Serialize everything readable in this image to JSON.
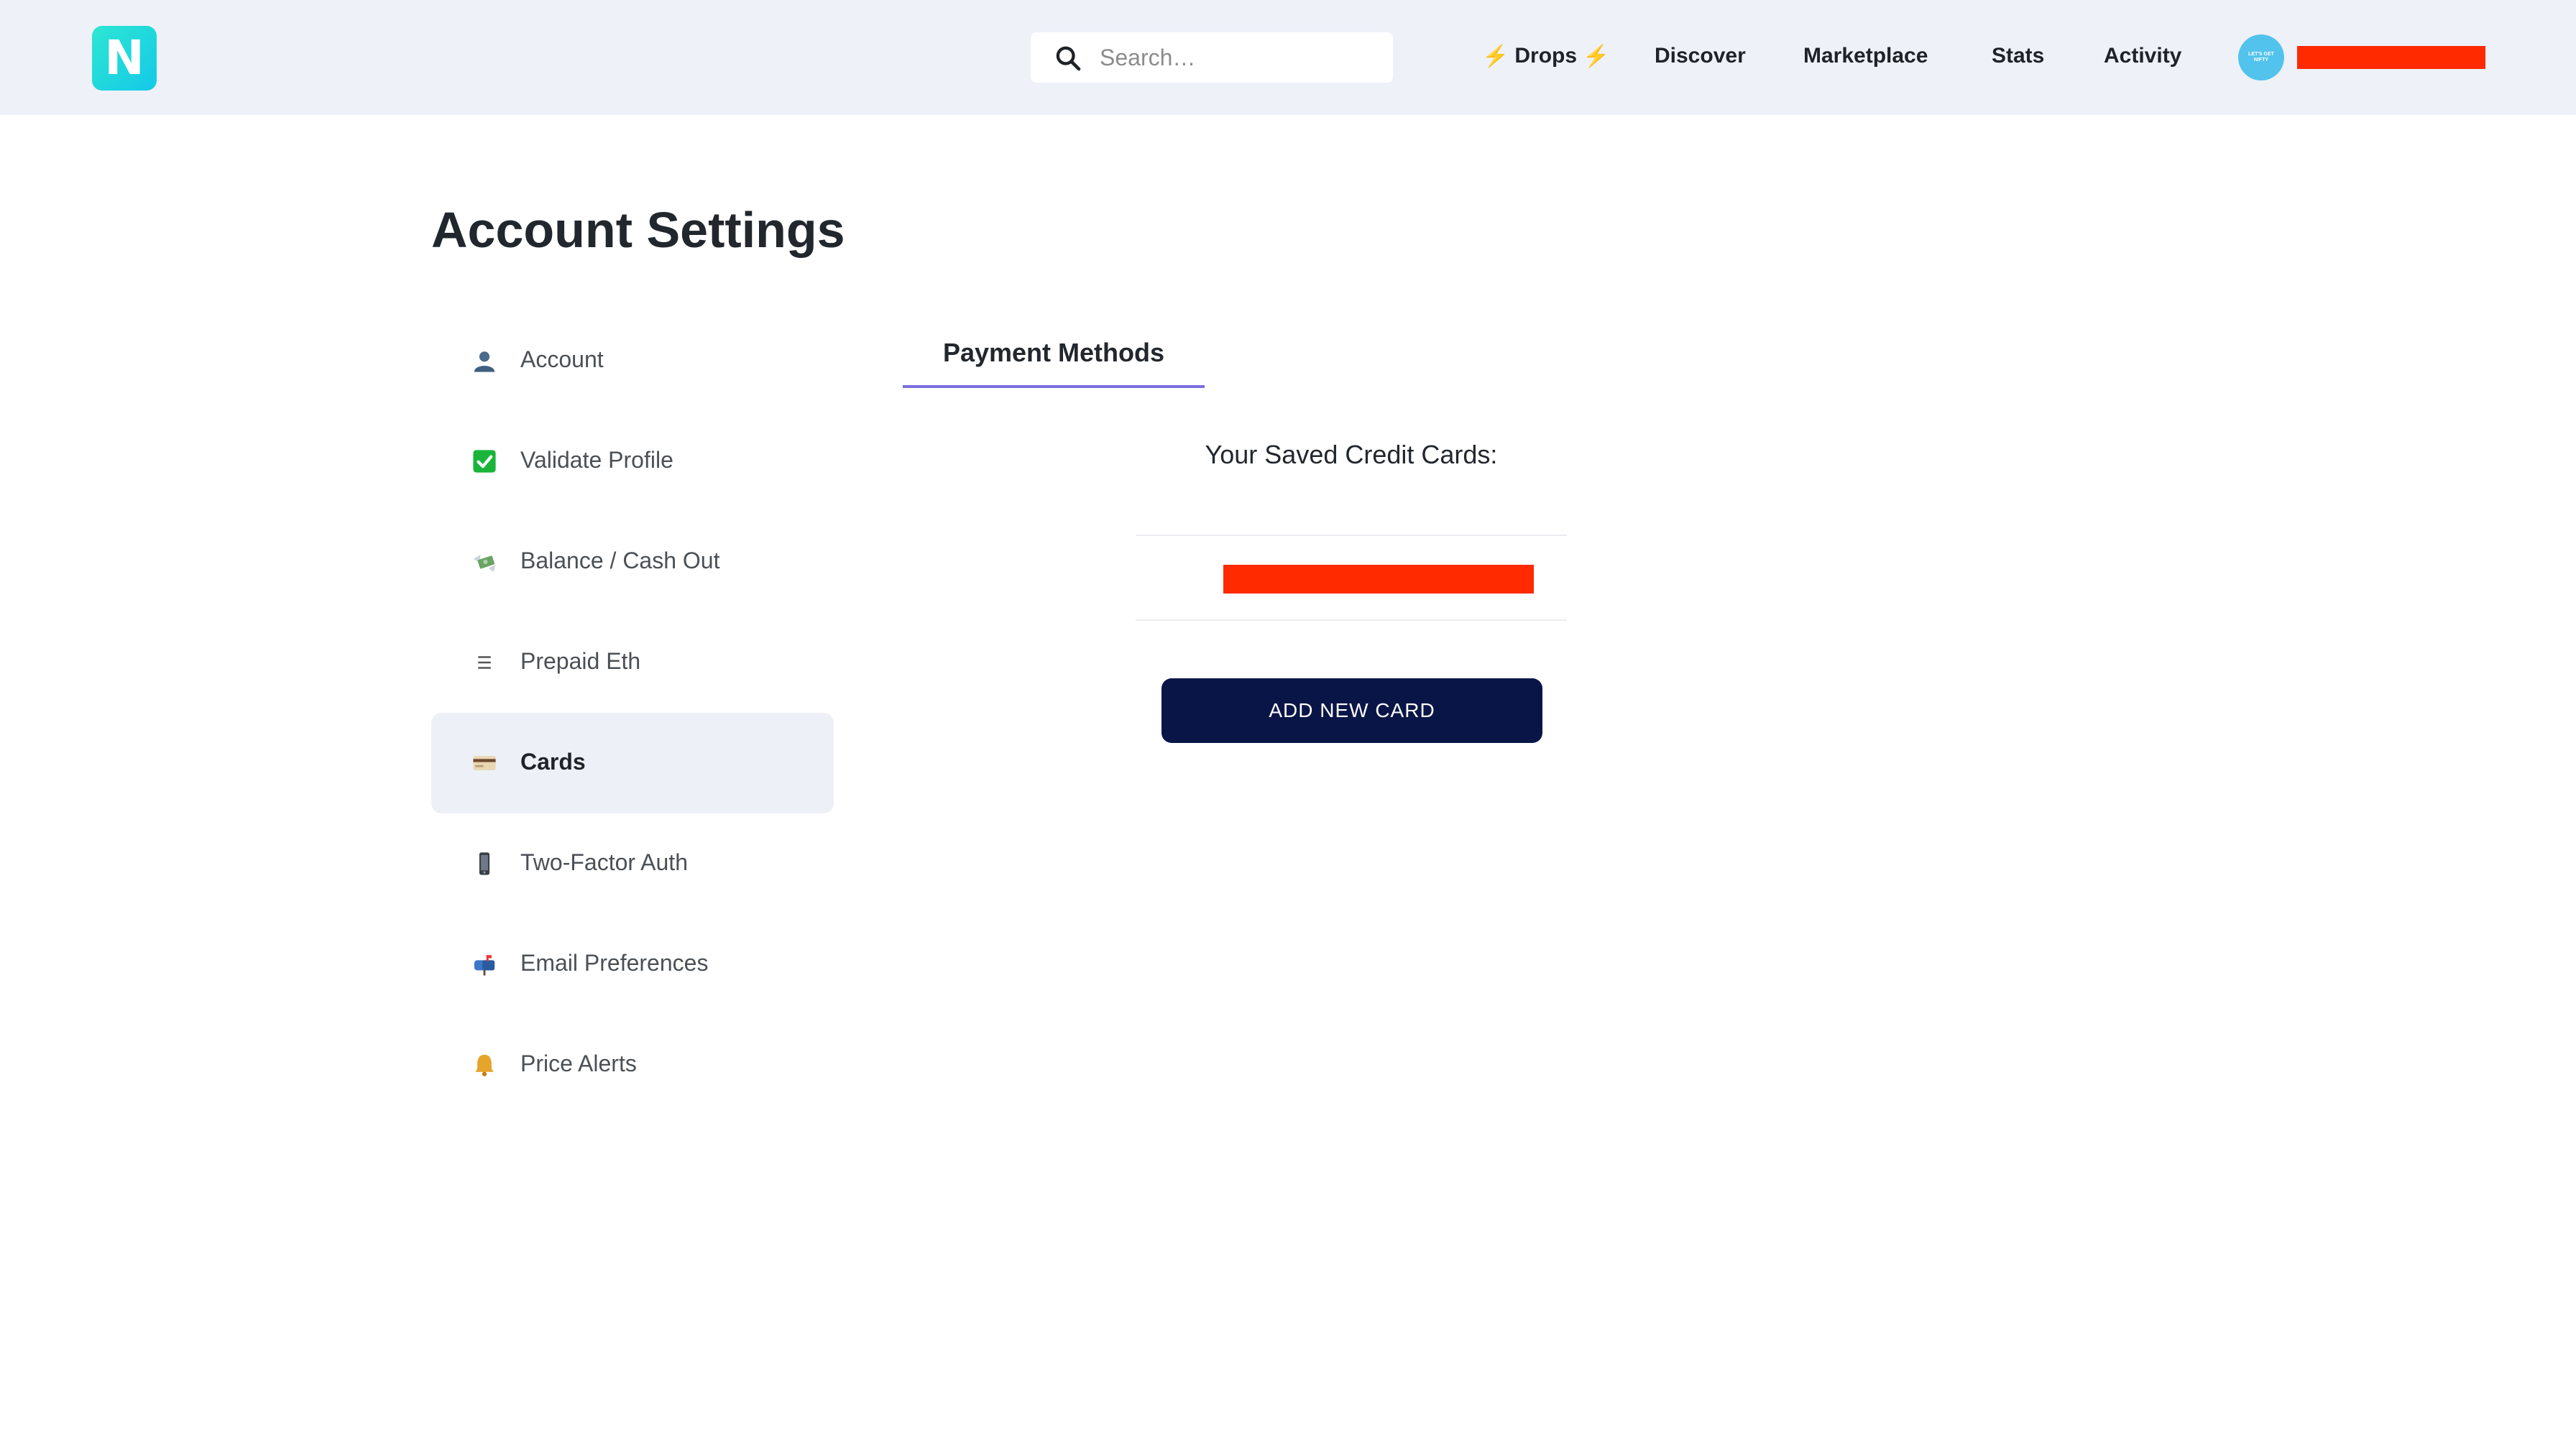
{
  "header": {
    "logo_letter": "N",
    "search_placeholder": "Search…",
    "nav": {
      "drops_bolt": "⚡",
      "drops": "Drops",
      "discover": "Discover",
      "marketplace": "Marketplace",
      "stats": "Stats",
      "activity": "Activity"
    },
    "avatar_text": "LET'S GET NIFTY"
  },
  "page": {
    "title": "Account Settings"
  },
  "sidebar": {
    "items": [
      {
        "icon": "bust-icon",
        "label": "Account"
      },
      {
        "icon": "check-mark-icon",
        "label": "Validate Profile"
      },
      {
        "icon": "money-wings-icon",
        "label": "Balance / Cash Out"
      },
      {
        "icon": "ethereum-icon",
        "label": "Prepaid Eth"
      },
      {
        "icon": "credit-card-icon",
        "label": "Cards",
        "active": true
      },
      {
        "icon": "mobile-phone-icon",
        "label": "Two-Factor Auth"
      },
      {
        "icon": "mailbox-icon",
        "label": "Email Preferences"
      },
      {
        "icon": "bell-icon",
        "label": "Price Alerts"
      }
    ]
  },
  "content": {
    "tab_label": "Payment Methods",
    "saved_title": "Your Saved Credit Cards:",
    "add_card_label": "ADD NEW CARD"
  },
  "colors": {
    "header_bg": "#eef1f8",
    "accent": "#7b6fe0",
    "button_bg": "#0a1547",
    "redaction": "#ff2a00",
    "logo": "#14c9e8"
  }
}
